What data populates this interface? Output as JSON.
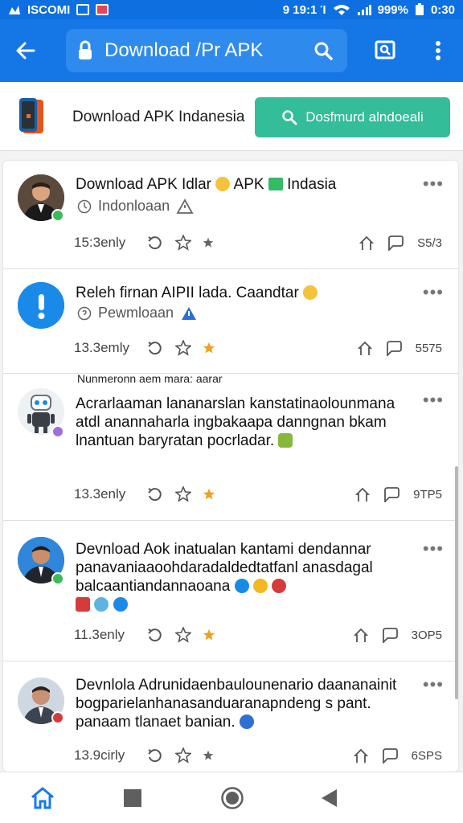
{
  "statusbar": {
    "carrier": "ISCOMI",
    "icons_right": "9 19:1 Ί",
    "battery": "999%",
    "time": "0:30"
  },
  "appbar": {
    "url_title": "Download /Pr APK"
  },
  "banner": {
    "title": "Download APK Indanesia",
    "button_label": "Dosfmurd alndoeali"
  },
  "posts": [
    {
      "title": "Download APK Idlar",
      "title_suffix": "APK",
      "title_tail": "Indasia",
      "sub": "Indonloaan",
      "time": "15:3enly",
      "count": "S5/3"
    },
    {
      "title": "Releh  firnan AIPII lada. Caandtar",
      "sub": "Pewmloaan",
      "time": "13.3emly",
      "count": "5575"
    },
    {
      "snippet_top": "Nunmeronn aem mara: aarar",
      "title": "Acrarlaaman lananarslan kanstatinaolounmana atdl anannaharla ingbakaapa danngnan bkam lnantuan baryratan pocrladar.",
      "time": "13.3enly",
      "count": "9TP5"
    },
    {
      "title": "Devnload Aok inatualan kantami dendannar panavaniaaoohdaradaldedtatfanl anasdagal balcaantiandannaoana",
      "time": "11.3enly",
      "count": "3OP5"
    },
    {
      "title": "Devnlola Adrunidaenbaulounenario daananainit bogparielanhanasanduaranapndeng s pant. panaam tlanaet banian.",
      "time": "13.9cirly",
      "count": "6SPS"
    }
  ],
  "colors": {
    "primary": "#1577e6",
    "statusbar": "#0d6fe0",
    "accent_button": "#33bd98",
    "star": "#f0a020"
  },
  "icons": {
    "back": "arrow-left-icon",
    "lock": "lock-icon",
    "search": "search-icon",
    "bookmark": "bookmark-search-icon",
    "menu": "more-vert-icon",
    "home": "home-icon",
    "square": "recents-square-icon",
    "circle": "home-circle-icon",
    "triangle": "back-triangle-icon"
  }
}
